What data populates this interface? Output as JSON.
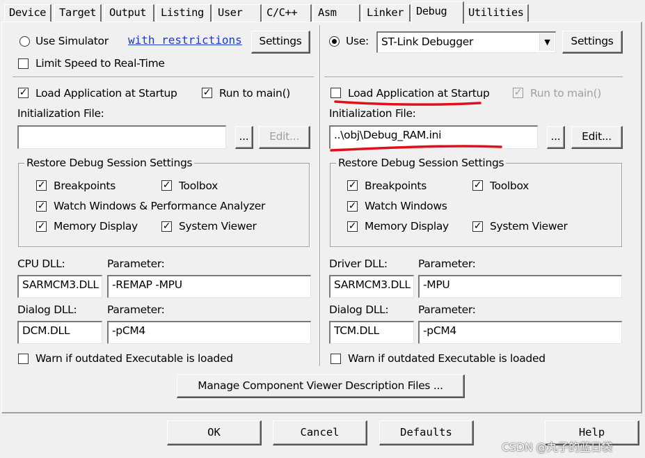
{
  "tabs": [
    "Device",
    "Target",
    "Output",
    "Listing",
    "User",
    "C/C++",
    "Asm",
    "Linker",
    "Debug",
    "Utilities"
  ],
  "left": {
    "use_simulator": "Use Simulator",
    "with_restrictions": "with restrictions",
    "settings": "Settings",
    "limit_speed": "Limit Speed to Real-Time",
    "load_app": "Load Application at Startup",
    "run_to_main": "Run to main()",
    "init_file_label": "Initialization File:",
    "init_file_value": "",
    "browse": "...",
    "edit": "Edit...",
    "restore_title": "Restore Debug Session Settings",
    "breakpoints": "Breakpoints",
    "toolbox": "Toolbox",
    "watch": "Watch Windows & Performance Analyzer",
    "memory": "Memory Display",
    "system_viewer": "System Viewer",
    "cpu_dll_label": "CPU DLL:",
    "cpu_param_label": "Parameter:",
    "cpu_dll": "SARMCM3.DLL",
    "cpu_param": "-REMAP -MPU",
    "dialog_dll_label": "Dialog DLL:",
    "dialog_param_label": "Parameter:",
    "dialog_dll": "DCM.DLL",
    "dialog_param": "-pCM4",
    "warn": "Warn if outdated Executable is loaded"
  },
  "right": {
    "use_label": "Use:",
    "debugger": "ST-Link Debugger",
    "settings": "Settings",
    "load_app": "Load Application at Startup",
    "run_to_main": "Run to main()",
    "init_file_label": "Initialization File:",
    "init_file_value": "..\\obj\\Debug_RAM.ini",
    "browse": "...",
    "edit": "Edit...",
    "restore_title": "Restore Debug Session Settings",
    "breakpoints": "Breakpoints",
    "toolbox": "Toolbox",
    "watch": "Watch Windows",
    "memory": "Memory Display",
    "system_viewer": "System Viewer",
    "driver_dll_label": "Driver DLL:",
    "driver_param_label": "Parameter:",
    "driver_dll": "SARMCM3.DLL",
    "driver_param": "-MPU",
    "dialog_dll_label": "Dialog DLL:",
    "dialog_param_label": "Parameter:",
    "dialog_dll": "TCM.DLL",
    "dialog_param": "-pCM4",
    "warn": "Warn if outdated Executable is loaded"
  },
  "manage_button": "Manage Component Viewer Description Files ...",
  "footer": {
    "ok": "OK",
    "cancel": "Cancel",
    "defaults": "Defaults",
    "help": "Help"
  },
  "watermark": "CSDN @丸子的蓝日袋",
  "annotation_color": "#e0101a"
}
